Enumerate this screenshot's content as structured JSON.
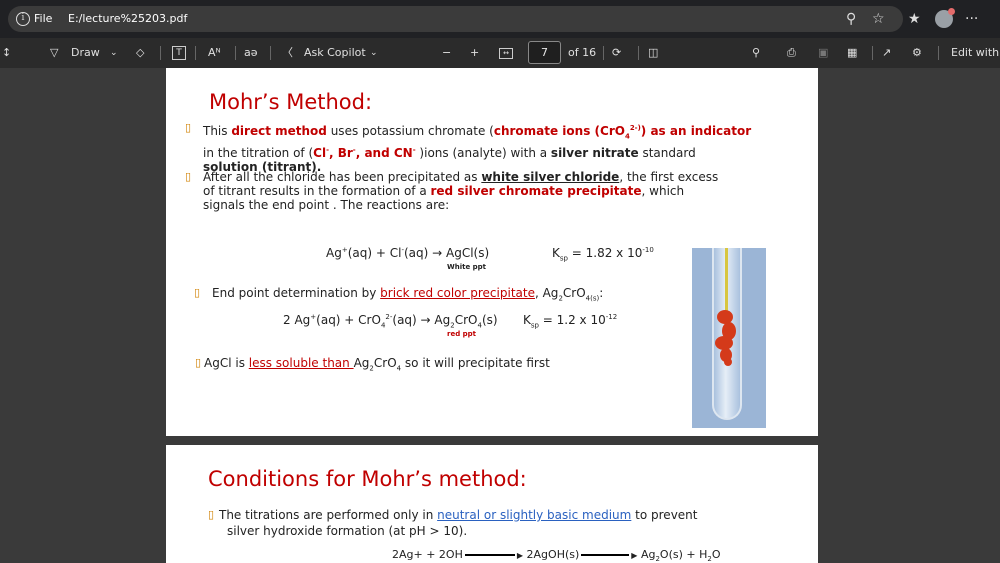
{
  "browser": {
    "info_glyph": "i",
    "file_label": "File",
    "url": "E:/lecture%25203.pdf",
    "menu_glyph": "···"
  },
  "toolbar": {
    "draw_label": "Draw",
    "text_glyph": "Aᴺ",
    "read_glyph": "aə",
    "ask_copilot_label": "Ask Copilot",
    "zoom_out_glyph": "−",
    "zoom_in_glyph": "+",
    "page_number": "7",
    "page_total": "of 16",
    "edit_label": "Edit with A"
  },
  "slide1": {
    "title": "Mohr’s Method:",
    "bullet1": {
      "t1": "This ",
      "t2": "direct method",
      "t3": " uses potassium chromate (",
      "t4": "chromate ions (CrO",
      "t5": "4",
      "t6": "2-)",
      "t7": ") as an  indicator",
      "t8": "in the titration of (",
      "t9": "Cl",
      "t10": "-",
      "t11": ", Br",
      "t12": "-",
      "t13": ", and CN",
      "t14": "-",
      "t15": " )ions (analyte) with a ",
      "t16": "silver nitrate",
      "t17": "  standard",
      "t18": "solution (titrant)."
    },
    "bullet2": {
      "t1": "After all the chloride has been precipitated as ",
      "t2": "white silver chloride",
      "t3": ", the first excess",
      "t4": "of titrant results in the formation of a ",
      "t5": "red silver chromate precipitate",
      "t6": ", which",
      "t7": "signals the end point . The reactions are:"
    },
    "eq1": {
      "a": "Ag",
      "b": "+",
      "c": "(aq) + Cl",
      "d": "-",
      "e": "(aq) → AgCl(s)",
      "ksp_a": "K",
      "ksp_b": "sp",
      "ksp_c": " = 1.82 x 10",
      "ksp_d": "-10",
      "note": "White ppt"
    },
    "bullet3": {
      "t1": "End point determination by ",
      "t2": "brick  red color precipitate",
      "t3": ", Ag",
      "t4": "2",
      "t5": "CrO",
      "t6": "4(s)",
      "t7": ":"
    },
    "eq2": {
      "a": "2 Ag",
      "b": "+",
      "c": "(aq) + CrO",
      "d": "4",
      "e": "2-",
      "f": "(aq) → Ag",
      "g": "2",
      "h": "CrO",
      "i": "4",
      "j": "(s)",
      "ksp_a": "K",
      "ksp_b": "sp",
      "ksp_c": " = 1.2 x 10",
      "ksp_d": "-12",
      "note": "red ppt"
    },
    "bullet4": {
      "t1": "AgCl is ",
      "t2": "less soluble than ",
      "t3": "Ag",
      "t4": "2",
      "t5": "CrO",
      "t6": "4",
      "t7": " so it will precipitate first"
    }
  },
  "slide2": {
    "title": "Conditions for Mohr’s method:",
    "bullet1": {
      "t1": "The titrations are performed only in ",
      "t2": "neutral or slightly basic medium",
      "t3": " to prevent",
      "t4": "silver hydroxide formation (at pH > 10)."
    },
    "eq": {
      "a": "2Ag+ + 2OH",
      "b": "2AgOH(s)",
      "c": "Ag",
      "d": "2",
      "e": "O(s) + H",
      "f": "2",
      "g": "O"
    }
  },
  "bullet_marker": "▯",
  "colors": {
    "accent_red": "#c00000",
    "link_blue": "#2a61c0",
    "bullet_orange": "#d08000"
  }
}
